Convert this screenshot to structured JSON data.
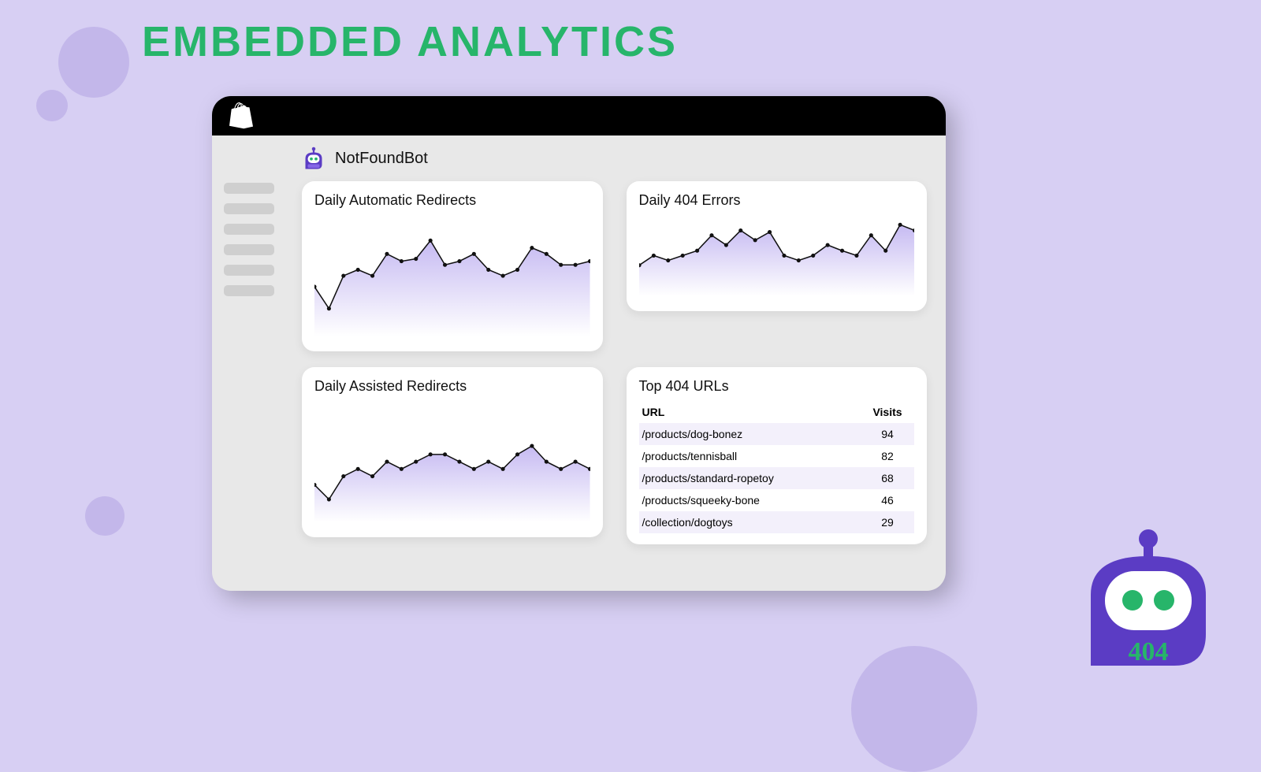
{
  "page_title": "EMBEDDED ANALYTICS",
  "app_name": "NotFoundBot",
  "cards": {
    "auto": {
      "title": "Daily Automatic Redirects"
    },
    "errors": {
      "title": "Daily 404 Errors"
    },
    "assisted": {
      "title": "Daily Assisted Redirects"
    },
    "top": {
      "title": "Top 404 URLs",
      "col_url": "URL",
      "col_visits": "Visits",
      "rows": [
        {
          "url": "/products/dog-bonez",
          "visits": 94
        },
        {
          "url": "/products/tennisball",
          "visits": 82
        },
        {
          "url": "/products/standard-ropetoy",
          "visits": 68
        },
        {
          "url": "/products/squeeky-bone",
          "visits": 46
        },
        {
          "url": "/collection/dogtoys",
          "visits": 29
        }
      ]
    }
  },
  "corner_badge": "404",
  "chart_data": [
    {
      "type": "area",
      "title": "Daily Automatic Redirects",
      "x": [
        0,
        1,
        2,
        3,
        4,
        5,
        6,
        7,
        8,
        9,
        10,
        11,
        12,
        13,
        14,
        15,
        16,
        17,
        18,
        19
      ],
      "values": [
        41,
        23,
        50,
        55,
        50,
        68,
        62,
        64,
        79,
        59,
        62,
        68,
        55,
        50,
        55,
        73,
        68,
        59,
        59,
        62
      ],
      "xlabel": "",
      "ylabel": "",
      "ylim": [
        0,
        100
      ]
    },
    {
      "type": "area",
      "title": "Daily 404 Errors",
      "x": [
        0,
        1,
        2,
        3,
        4,
        5,
        6,
        7,
        8,
        9,
        10,
        11,
        12,
        13,
        14,
        15,
        16,
        17,
        18,
        19
      ],
      "values": [
        38,
        50,
        44,
        50,
        56,
        75,
        63,
        81,
        69,
        79,
        50,
        44,
        50,
        63,
        56,
        50,
        75,
        56,
        88,
        81
      ],
      "xlabel": "",
      "ylabel": "",
      "ylim": [
        0,
        100
      ]
    },
    {
      "type": "area",
      "title": "Daily Assisted Redirects",
      "x": [
        0,
        1,
        2,
        3,
        4,
        5,
        6,
        7,
        8,
        9,
        10,
        11,
        12,
        13,
        14,
        15,
        16,
        17,
        18,
        19
      ],
      "values": [
        31,
        19,
        38,
        44,
        38,
        50,
        44,
        50,
        56,
        56,
        50,
        44,
        50,
        44,
        56,
        63,
        50,
        44,
        50,
        44
      ],
      "xlabel": "",
      "ylabel": "",
      "ylim": [
        0,
        100
      ]
    }
  ]
}
